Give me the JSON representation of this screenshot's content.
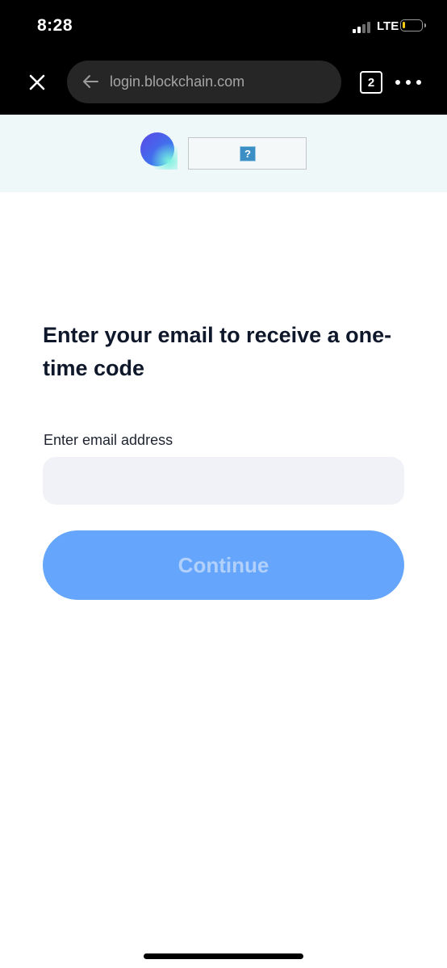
{
  "status_bar": {
    "time": "8:28",
    "network": "LTE",
    "battery_level": 0.15,
    "signal_bars_filled": 2,
    "signal_bars_total": 4
  },
  "browser": {
    "url": "login.blockchain.com",
    "tab_count": "2",
    "icons": [
      "close-icon",
      "back-arrow-icon",
      "tabs-icon",
      "more-icon"
    ]
  },
  "header": {
    "broken_image_glyph": "?",
    "logo_colors": [
      "#3b6cf0",
      "#54e4d8"
    ],
    "background": "#eff8f9"
  },
  "form": {
    "heading": "Enter your email to receive a one-time code",
    "email_label": "Enter email address",
    "email_value": "",
    "email_placeholder": "",
    "continue_label": "Continue",
    "continue_enabled": false,
    "accent_color": "#65a5fb"
  }
}
